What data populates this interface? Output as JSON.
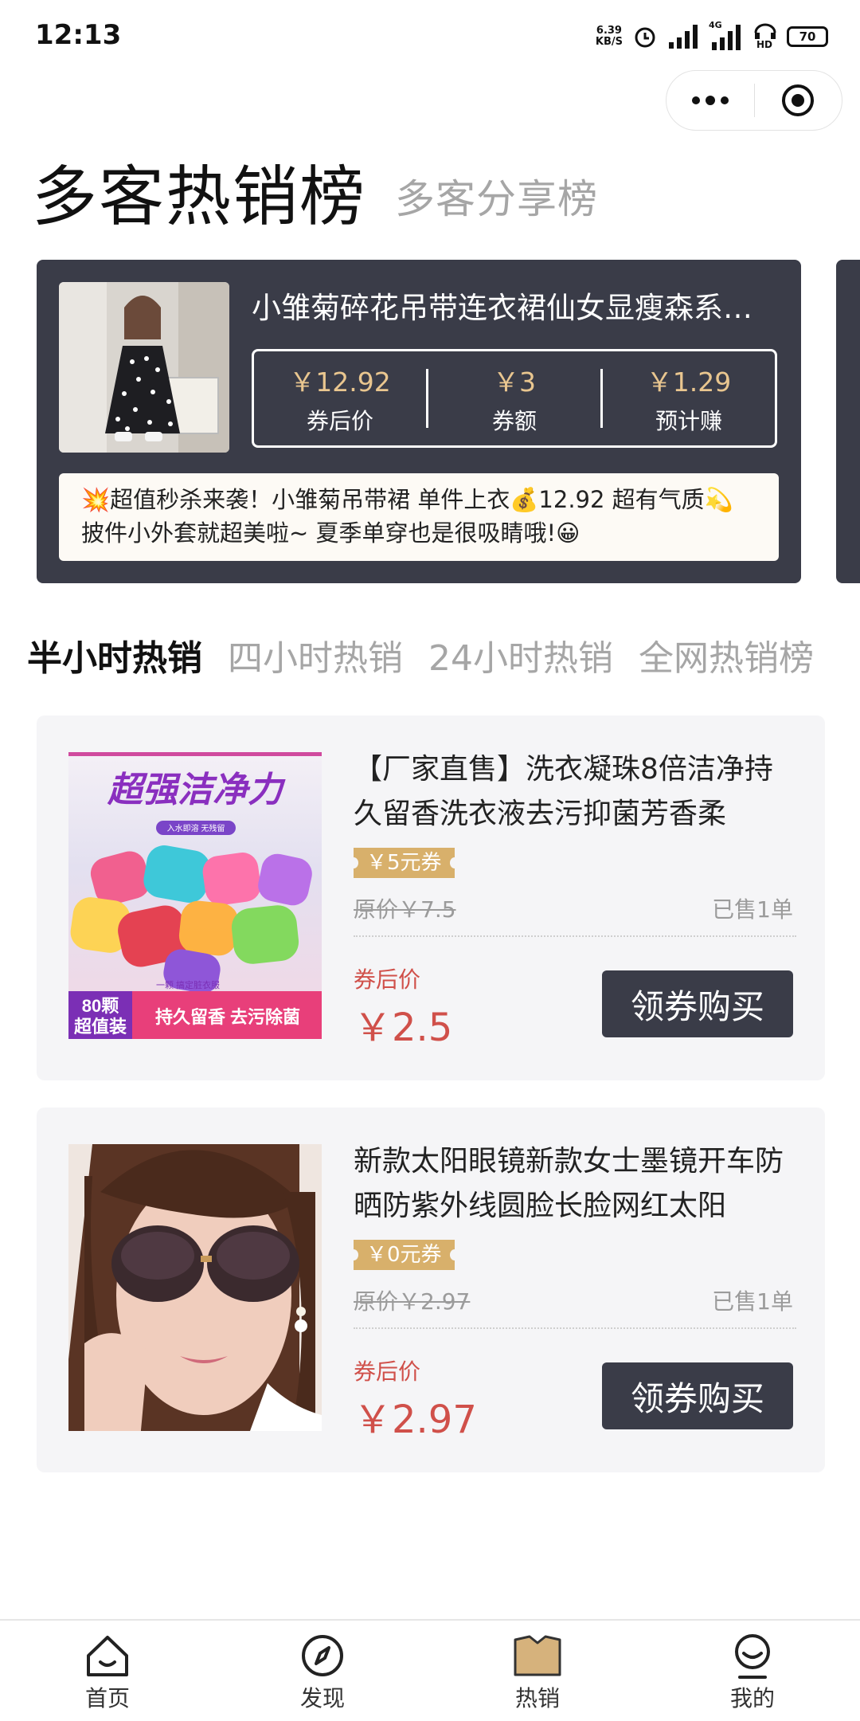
{
  "status_bar": {
    "time": "12:13",
    "net_speed_value": "6.39",
    "net_speed_unit": "KB/S",
    "network": "4G",
    "hd": "HD",
    "battery": "70"
  },
  "header": {
    "title": "多客热销榜",
    "subtitle": "多客分享榜"
  },
  "featured": {
    "title": "小雏菊碎花吊带连衣裙仙女显瘦森系…",
    "stats": [
      {
        "value": "￥12.92",
        "label": "券后价"
      },
      {
        "value": "￥3",
        "label": "券额"
      },
      {
        "value": "￥1.29",
        "label": "预计赚"
      }
    ],
    "description_line1": "💥超值秒杀来袭！小雏菊吊带裙 单件上衣💰12.92 超有气质💫",
    "description_line2": "披件小外套就超美啦~ 夏季单穿也是很吸睛哦!😀"
  },
  "tabs": [
    {
      "label": "半小时热销"
    },
    {
      "label": "四小时热销"
    },
    {
      "label": "24小时热销"
    },
    {
      "label": "全网热销榜"
    }
  ],
  "products": [
    {
      "title": "【厂家直售】洗衣凝珠8倍洁净持久留香洗衣液去污抑菌芳香柔",
      "coupon": "￥5元券",
      "original_price": "原价￥7.5",
      "sold": "已售1单",
      "after_label": "券后价",
      "after_price": "￥2.5",
      "button": "领券购买",
      "image_text": {
        "headline": "超强洁净力",
        "tagline": "入水即溶 无残留",
        "count": "80颗",
        "deal": "超值装",
        "features": "持久留香 去污除菌",
        "note": "一颗 搞定脏衣服"
      }
    },
    {
      "title": "新款太阳眼镜新款女士墨镜开车防晒防紫外线圆脸长脸网红太阳",
      "coupon": "￥0元券",
      "original_price": "原价￥2.97",
      "sold": "已售1单",
      "after_label": "券后价",
      "after_price": "￥2.97",
      "button": "领券购买"
    }
  ],
  "bottom_nav": [
    {
      "label": "首页",
      "icon": "home-icon"
    },
    {
      "label": "发现",
      "icon": "compass-icon"
    },
    {
      "label": "热销",
      "icon": "hot-icon"
    },
    {
      "label": "我的",
      "icon": "profile-icon"
    }
  ],
  "colors": {
    "card_dark": "#3a3c48",
    "accent_gold": "#d8b06b",
    "price_red": "#d0504a"
  }
}
